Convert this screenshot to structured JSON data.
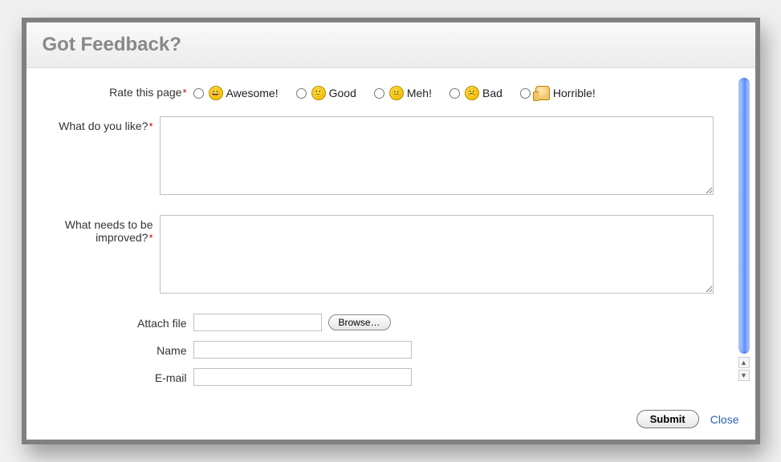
{
  "dialog": {
    "title": "Got Feedback?",
    "rate": {
      "label": "Rate this page",
      "options": [
        {
          "label": "Awesome!",
          "icon": "face-awesome"
        },
        {
          "label": "Good",
          "icon": "face-good"
        },
        {
          "label": "Meh!",
          "icon": "face-meh"
        },
        {
          "label": "Bad",
          "icon": "face-bad"
        },
        {
          "label": "Horrible!",
          "icon": "thumbs-down"
        }
      ]
    },
    "like": {
      "label": "What do you like?"
    },
    "improve": {
      "label": "What needs to be improved?"
    },
    "attach": {
      "label": "Attach file",
      "browse": "Browse…"
    },
    "name": {
      "label": "Name"
    },
    "email": {
      "label": "E-mail"
    },
    "submit": "Submit",
    "close": "Close"
  }
}
